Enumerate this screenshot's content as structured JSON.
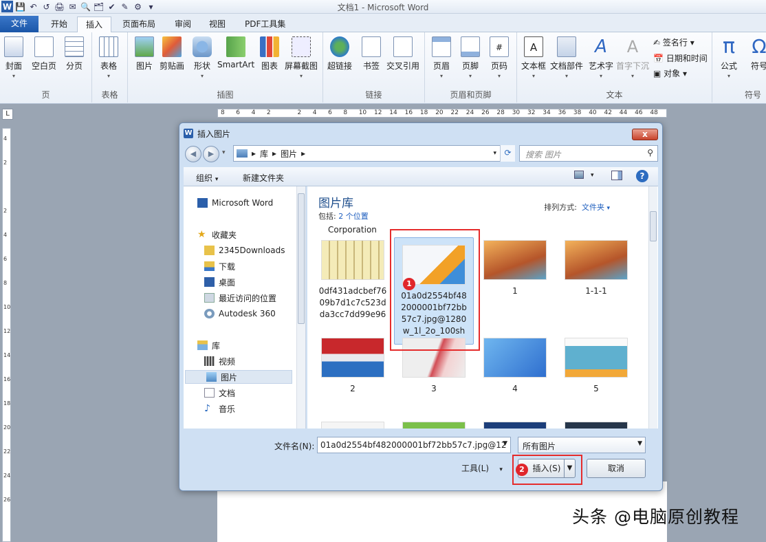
{
  "window": {
    "title": "文档1 - Microsoft Word"
  },
  "qat": [
    "W",
    "💾",
    "↶",
    "↺",
    "🖨",
    "✉",
    "🔍",
    "🗂",
    "✔",
    "✎",
    "⚙",
    "▾"
  ],
  "tabs": [
    "文件",
    "开始",
    "插入",
    "页面布局",
    "审阅",
    "视图",
    "PDF工具集"
  ],
  "ribbon": {
    "groups": {
      "page": {
        "label": "页",
        "buttons": [
          "封面",
          "空白页",
          "分页"
        ]
      },
      "table": {
        "label": "表格",
        "buttons": [
          "表格"
        ]
      },
      "illustrations": {
        "label": "插图",
        "buttons": [
          "图片",
          "剪贴画",
          "形状",
          "SmartArt",
          "图表",
          "屏幕截图"
        ]
      },
      "links": {
        "label": "链接",
        "buttons": [
          "超链接",
          "书签",
          "交叉引用"
        ]
      },
      "header_footer": {
        "label": "页眉和页脚",
        "buttons": [
          "页眉",
          "页脚",
          "页码"
        ]
      },
      "text": {
        "label": "文本",
        "buttons": [
          "文本框",
          "文档部件",
          "艺术字",
          "首字下沉"
        ],
        "small": [
          "签名行",
          "日期和时间",
          "对象"
        ]
      },
      "symbols": {
        "label": "符号",
        "buttons": [
          "公式",
          "符号"
        ]
      }
    }
  },
  "ruler_h": [
    "8",
    "6",
    "4",
    "2",
    "",
    "2",
    "4",
    "6",
    "8",
    "10",
    "12",
    "14",
    "16",
    "18",
    "20",
    "22",
    "24",
    "26",
    "28",
    "30",
    "32",
    "34",
    "36",
    "38",
    "40",
    "42",
    "44",
    "46",
    "48"
  ],
  "ruler_v": [
    "4",
    "2",
    "",
    "2",
    "4",
    "6",
    "8",
    "10",
    "12",
    "14",
    "16",
    "18",
    "20",
    "22",
    "24",
    "26"
  ],
  "dialog": {
    "title": "插入图片",
    "close_label": "x",
    "path": [
      "库",
      "图片"
    ],
    "search_placeholder": "搜索 图片",
    "toolbar": {
      "organize": "组织",
      "new_folder": "新建文件夹"
    },
    "nav": [
      "Microsoft Word",
      "收藏夹",
      "2345Downloads",
      "下载",
      "桌面",
      "最近访问的位置",
      "Autodesk 360",
      "库",
      "视频",
      "图片",
      "文档",
      "音乐"
    ],
    "library": {
      "title": "图片库",
      "includes_label": "包括:",
      "includes_value": "2 个位置",
      "sort_label": "排列方式:",
      "sort_value": "文件夹"
    },
    "partial_label": "Corporation",
    "files": [
      {
        "name": "0df431adcbef7609b7d1c7c523dda3cc7dd99e96",
        "color": "#f4ebb8"
      },
      {
        "name": "01a0d2554bf482000001bf72bb57c7.jpg@1280w_1l_2o_100sh",
        "color": "#eef2f6"
      },
      {
        "name": "1",
        "color": "#d98a44"
      },
      {
        "name": "1-1-1",
        "color": "#d98a44"
      },
      {
        "name": "2",
        "color": "#c8282c"
      },
      {
        "name": "3",
        "color": "#e7e1e1"
      },
      {
        "name": "4",
        "color": "#3f8ad6"
      },
      {
        "name": "5",
        "color": "#5fb0cf"
      }
    ],
    "annotations": [
      "1",
      "2"
    ],
    "filename_label": "文件名(N):",
    "filename_value": "01a0d2554bf482000001bf72bb57c7.jpg@12",
    "filetype": "所有图片",
    "tools_label": "工具(L)",
    "insert_label": "插入(S)",
    "cancel_label": "取消"
  },
  "watermark": "头条 @电脑原创教程"
}
